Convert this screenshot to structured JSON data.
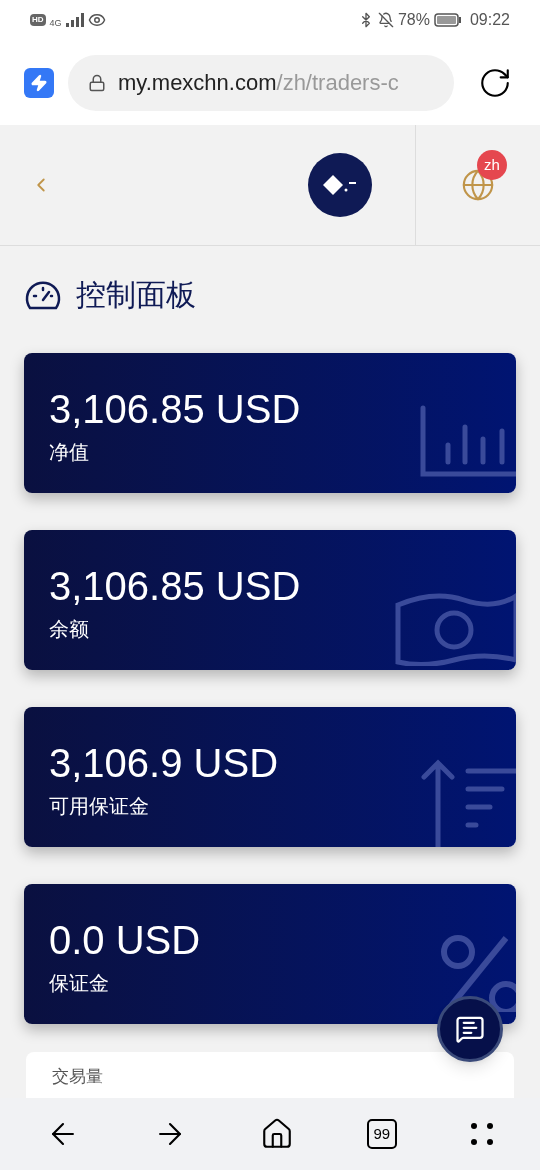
{
  "status_bar": {
    "hd": "HD",
    "network": "4G",
    "battery": "78%",
    "time": "09:22"
  },
  "browser": {
    "url_host": "my.mexchn.com",
    "url_path": "/zh/traders-c"
  },
  "header": {
    "language_badge": "zh"
  },
  "page_title": "控制面板",
  "cards": [
    {
      "value": "3,106.85 USD",
      "label": "净值",
      "kind": "chart"
    },
    {
      "value": "3,106.85 USD",
      "label": "余额",
      "kind": "money"
    },
    {
      "value": "3,106.9 USD",
      "label": "可用保证金",
      "kind": "margin"
    },
    {
      "value": "0.0 USD",
      "label": "保证金",
      "kind": "percent"
    }
  ],
  "next_card": {
    "title": "交易量"
  },
  "bottom_nav": {
    "tabs_count": "99"
  }
}
